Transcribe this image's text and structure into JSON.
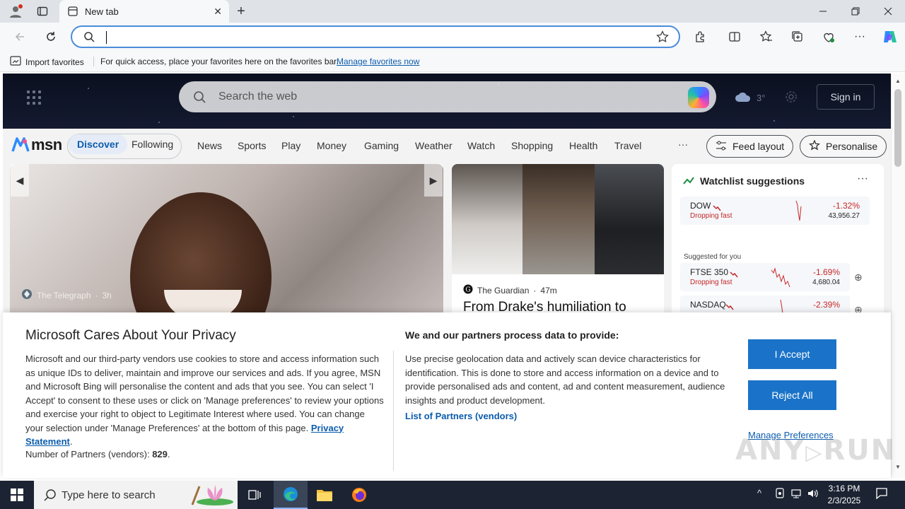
{
  "browser": {
    "tab_title": "New tab",
    "favorites_bar": {
      "import_label": "Import favorites",
      "hint": "For quick access, place your favorites here on the favorites bar.",
      "manage_link": "Manage favorites now"
    }
  },
  "msn": {
    "search_placeholder": "Search the web",
    "weather_temp": "3°",
    "signin": "Sign in",
    "logo": "msn",
    "tabs": [
      "Discover",
      "Following"
    ],
    "nav": [
      "News",
      "Sports",
      "Play",
      "Money",
      "Gaming",
      "Weather",
      "Watch",
      "Shopping",
      "Health",
      "Travel"
    ],
    "more": "···",
    "feed_layout": "Feed layout",
    "personalise": "Personalise",
    "hero_card": {
      "source": "The Telegraph",
      "age": "3h"
    },
    "mid_card": {
      "source": "The Guardian",
      "age": "47m",
      "headline": "From Drake's humiliation to"
    },
    "watchlist": {
      "title": "Watchlist suggestions",
      "suggested_label": "Suggested for you",
      "stocks": [
        {
          "name": "DOW",
          "status": "Dropping fast",
          "change": "-1.32%",
          "value": "43,956.27"
        },
        {
          "name": "FTSE 350",
          "status": "Dropping fast",
          "change": "-1.69%",
          "value": "4,680.04"
        },
        {
          "name": "NASDAQ",
          "status": "",
          "change": "-2.39%",
          "value": ""
        }
      ]
    }
  },
  "privacy": {
    "title": "Microsoft Cares About Your Privacy",
    "body": "Microsoft and our third-party vendors use cookies to store and access information such as unique IDs to deliver, maintain and improve our services and ads. If you agree, MSN and Microsoft Bing will personalise the content and ads that you see. You can select 'I Accept' to consent to these uses or click on 'Manage preferences' to review your options and exercise your right to object to Legitimate Interest where used.  You can change your selection under 'Manage Preferences' at the bottom of this page.",
    "privacy_link": "Privacy Statement",
    "partners_count_label": "Number of Partners (vendors):",
    "partners_count": "829",
    "process_heading": "We and our partners process data to provide:",
    "process_body": "Use precise geolocation data and actively scan device characteristics for identification. This is done to store and access information on a device and to provide personalised ads and content, ad and content measurement, audience insights and product development.",
    "partners_link": "List of Partners (vendors)",
    "accept": "I Accept",
    "reject": "Reject All",
    "manage": "Manage Preferences",
    "watermark": "ANY RUN"
  },
  "taskbar": {
    "search_placeholder": "Type here to search",
    "time": "3:16 PM",
    "date": "2/3/2025"
  },
  "colors": {
    "accent": "#1a73c8",
    "link": "#0b5cad",
    "negative": "#c62828",
    "taskbar": "#1c2433"
  }
}
